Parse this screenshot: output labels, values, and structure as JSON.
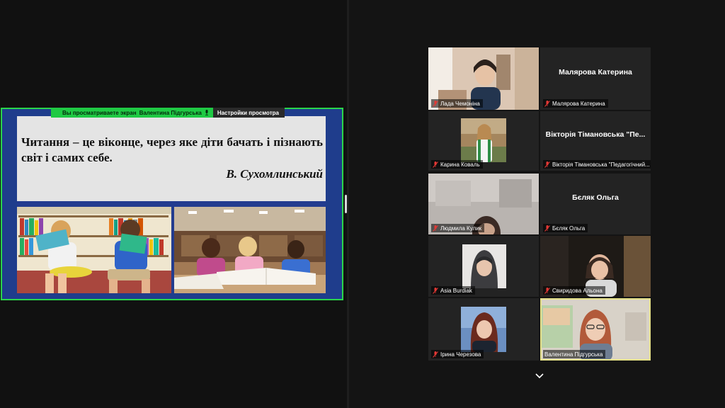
{
  "share_bar": {
    "viewing_label": "Вы просматриваете экран",
    "presenter_name": "Валентина Підгурська",
    "settings_label": "Настройки просмотра"
  },
  "slide": {
    "quote": "Читання – це віконце, через яке діти бачать і пізнають світ і самих себе.",
    "author": "В. Сухомлинський"
  },
  "participants": [
    {
      "name": "Лада Чемоніна",
      "video": true,
      "muted": true
    },
    {
      "name": "Малярова Катерина",
      "video": false,
      "muted": true,
      "display": "Малярова Катерина"
    },
    {
      "name": "Карина Коваль",
      "video": true,
      "muted": true
    },
    {
      "name": "Вікторія Тімановська \"Педагогічний...",
      "video": false,
      "muted": true,
      "display": "Вікторія Тімановська \"Пе..."
    },
    {
      "name": "Людмила Кулик",
      "video": true,
      "muted": true
    },
    {
      "name": "Бєляк Ольга",
      "video": false,
      "muted": true,
      "display": "Бєляк Ольга"
    },
    {
      "name": "Asia Burdiak",
      "video": true,
      "muted": true
    },
    {
      "name": "Свиридова Альона",
      "video": true,
      "muted": true
    },
    {
      "name": "Ірина Черезова",
      "video": true,
      "muted": true
    },
    {
      "name": "Валентина Підгурська",
      "video": true,
      "muted": false,
      "active": true
    }
  ],
  "colors": {
    "share_border": "#2bd64a",
    "share_bar": "#1fc944",
    "slide_background": "#233c8f",
    "active_speaker": "#e6e28a",
    "mute_icon": "#e53935"
  }
}
